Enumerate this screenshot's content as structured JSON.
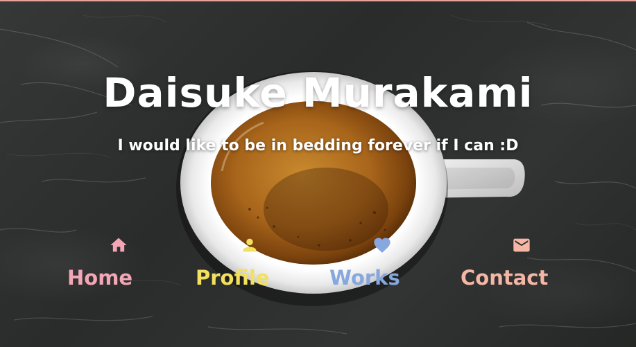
{
  "hero": {
    "title": "Daisuke Murakami",
    "tagline": "I would like to be in bedding forever if I can :D"
  },
  "nav": {
    "items": [
      {
        "label": "Home",
        "icon": "home-icon",
        "color": "#f3a6b6"
      },
      {
        "label": "Profile",
        "icon": "person-icon",
        "color": "#f2e05e"
      },
      {
        "label": "Works",
        "icon": "heart-icon",
        "color": "#86a8de"
      },
      {
        "label": "Contact",
        "icon": "mail-icon",
        "color": "#f6b6a6"
      }
    ]
  },
  "colors": {
    "background": "#2b2d2c",
    "top_border": "#e7a29a",
    "text": "#ffffff"
  }
}
